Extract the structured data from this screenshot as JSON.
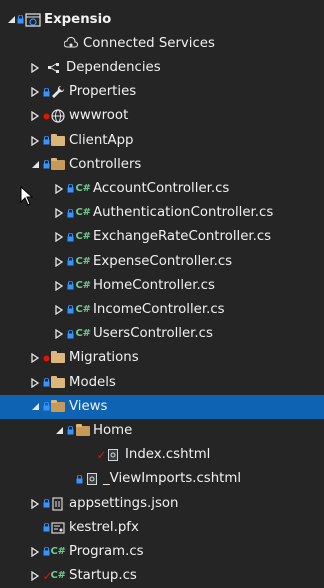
{
  "rows": [
    {
      "label": "Expensio",
      "ctl": "open",
      "lock": true,
      "icon": "web-project-icon"
    },
    {
      "label": "Connected Services",
      "ctl": "none",
      "lock": false,
      "icon": "connected-services-icon"
    },
    {
      "label": "Dependencies",
      "ctl": "closed",
      "lock": false,
      "icon": "dependencies-icon"
    },
    {
      "label": "Properties",
      "ctl": "closed",
      "lock": true,
      "icon": "wrench-icon"
    },
    {
      "label": "wwwroot",
      "ctl": "closed",
      "lock": false,
      "status": "error",
      "icon": "globe-icon"
    },
    {
      "label": "ClientApp",
      "ctl": "closed",
      "lock": true,
      "icon": "folder-icon"
    },
    {
      "label": "Controllers",
      "ctl": "open",
      "lock": true,
      "icon": "folder-open-icon"
    },
    {
      "label": "AccountController.cs",
      "ctl": "closed",
      "lock": true,
      "icon": "csharp-file-icon"
    },
    {
      "label": "AuthenticationController.cs",
      "ctl": "closed",
      "lock": true,
      "icon": "csharp-file-icon"
    },
    {
      "label": "ExchangeRateController.cs",
      "ctl": "closed",
      "lock": true,
      "icon": "csharp-file-icon"
    },
    {
      "label": "ExpenseController.cs",
      "ctl": "closed",
      "lock": true,
      "icon": "csharp-file-icon"
    },
    {
      "label": "HomeController.cs",
      "ctl": "closed",
      "lock": true,
      "icon": "csharp-file-icon"
    },
    {
      "label": "IncomeController.cs",
      "ctl": "closed",
      "lock": true,
      "icon": "csharp-file-icon"
    },
    {
      "label": "UsersController.cs",
      "ctl": "closed",
      "lock": true,
      "icon": "csharp-file-icon"
    },
    {
      "label": "Migrations",
      "ctl": "closed",
      "lock": false,
      "status": "error",
      "icon": "folder-icon"
    },
    {
      "label": "Models",
      "ctl": "closed",
      "lock": true,
      "icon": "folder-icon"
    },
    {
      "label": "Views",
      "ctl": "open",
      "lock": true,
      "icon": "folder-open-icon",
      "selected": true
    },
    {
      "label": "Home",
      "ctl": "open",
      "lock": true,
      "icon": "folder-open-icon"
    },
    {
      "label": "Index.cshtml",
      "ctl": "none",
      "lock": false,
      "checked": true,
      "icon": "razor-file-icon"
    },
    {
      "label": "_ViewImports.cshtml",
      "ctl": "none",
      "lock": true,
      "icon": "razor-file-icon"
    },
    {
      "label": "appsettings.json",
      "ctl": "closed",
      "lock": true,
      "icon": "json-file-icon"
    },
    {
      "label": "kestrel.pfx",
      "ctl": "none",
      "lock": true,
      "icon": "certificate-icon"
    },
    {
      "label": "Program.cs",
      "ctl": "closed",
      "lock": true,
      "icon": "csharp-file-icon"
    },
    {
      "label": "Startup.cs",
      "ctl": "closed",
      "lock": false,
      "checked": true,
      "icon": "csharp-file-icon"
    }
  ],
  "colors": {
    "background": "#252526",
    "selection": "#0e63b3",
    "text": "#f1f1f1",
    "lock": "#3794ff",
    "error": "#e51400",
    "folder": "#dcb67a",
    "csharp": "#73c991"
  }
}
